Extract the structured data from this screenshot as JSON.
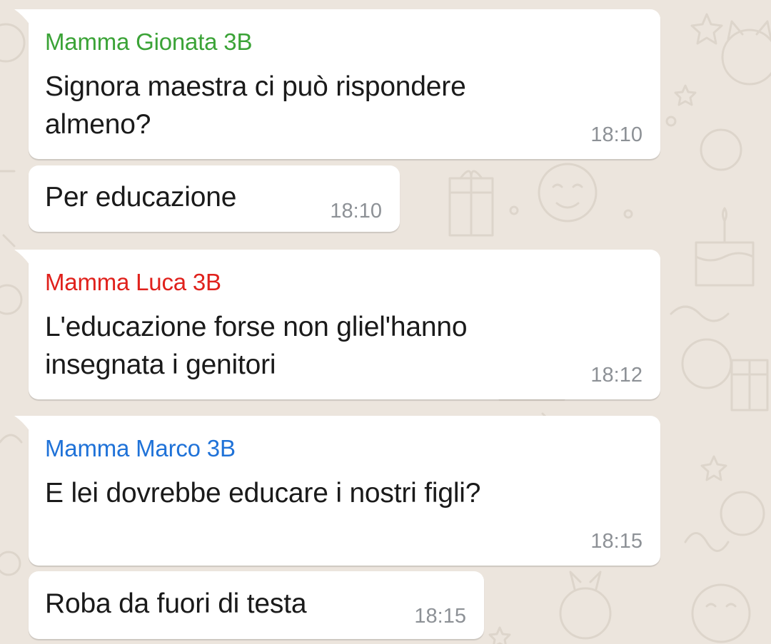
{
  "colors": {
    "chat_background": "#ece5dd",
    "bubble_background": "#ffffff",
    "timestamp": "#8d9196",
    "message_text": "#1a1a1a"
  },
  "messages": [
    {
      "sender": "Mamma Gionata 3B",
      "sender_color": "#3ba337",
      "text": "Signora maestra ci può rispondere\nalmeno?",
      "time": "18:10"
    },
    {
      "sender": null,
      "text": "Per educazione",
      "time": "18:10"
    },
    {
      "sender": "Mamma Luca 3B",
      "sender_color": "#e0211c",
      "text": "L'educazione forse non gliel'hanno\ninsegnata i genitori",
      "time": "18:12"
    },
    {
      "sender": "Mamma Marco 3B",
      "sender_color": "#1f72d8",
      "text": "E lei dovrebbe educare i nostri figli?",
      "time": "18:15"
    },
    {
      "sender": null,
      "text": "Roba da fuori di testa",
      "time": "18:15"
    }
  ]
}
